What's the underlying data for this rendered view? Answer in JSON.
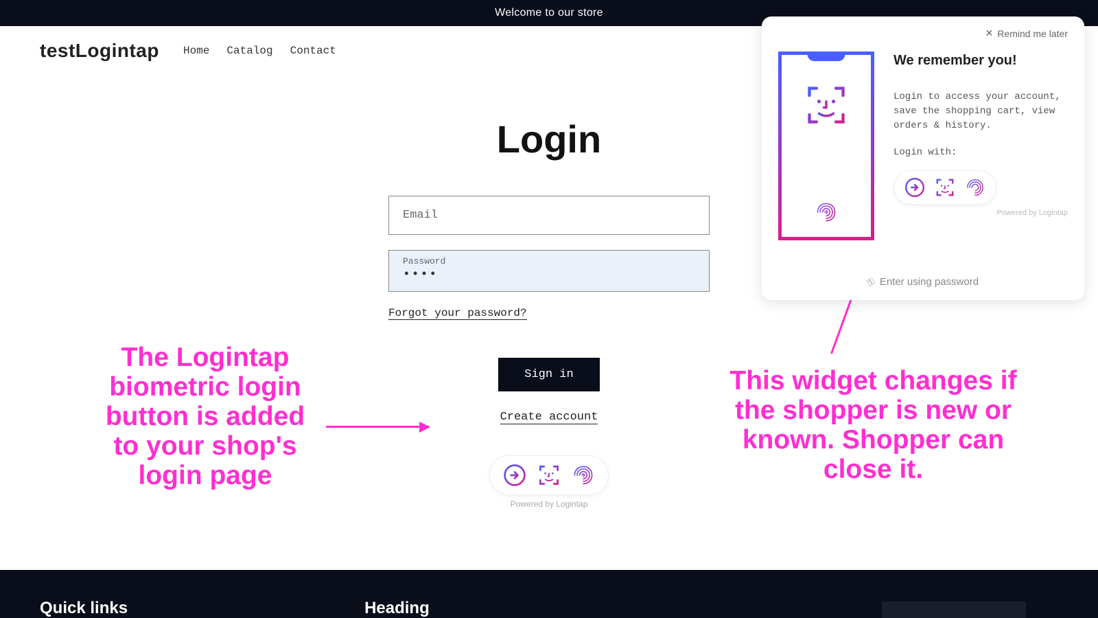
{
  "banner": {
    "text": "Welcome to our store"
  },
  "header": {
    "logo": "testLogintap",
    "nav": [
      "Home",
      "Catalog",
      "Contact"
    ]
  },
  "login": {
    "title": "Login",
    "email_placeholder": "Email",
    "password_label": "Password",
    "password_value": "••••",
    "forgot": "Forgot your password?",
    "signin": "Sign in",
    "create": "Create account",
    "powered": "Powered by Logintap"
  },
  "annotations": {
    "left": "The Logintap biometric login button is added to your shop's login page",
    "right": "This widget changes if the shopper is new or known. Shopper can close it."
  },
  "widget": {
    "close": "Remind me later",
    "title": "We remember you!",
    "desc": "Login to access your account, save the shopping cart, view orders & history.",
    "login_with": "Login with:",
    "powered": "Powered by Logintap",
    "footer": "Enter using password"
  },
  "footer": {
    "col1": "Quick links",
    "col2": "Heading"
  }
}
